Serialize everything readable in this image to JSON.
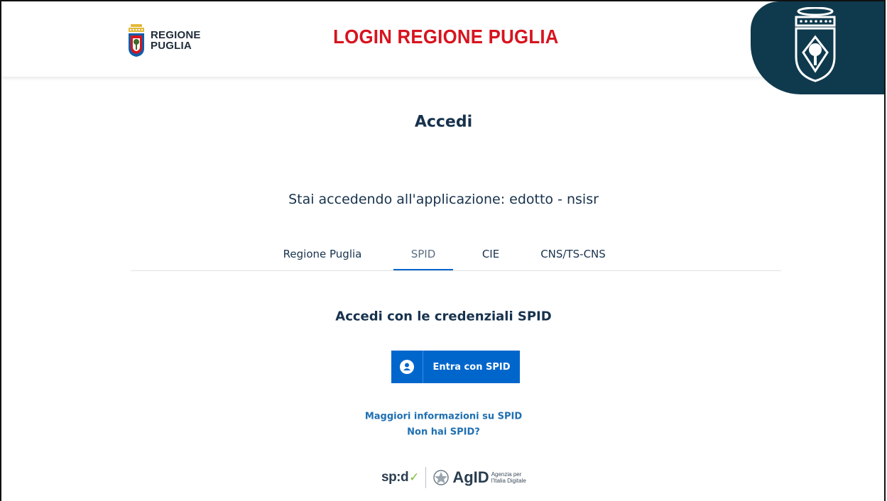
{
  "header": {
    "logo_line1": "REGIONE",
    "logo_line2": "PUGLIA",
    "title": "LOGIN REGIONE PUGLIA"
  },
  "main": {
    "page_title": "Accedi",
    "app_line": "Stai accedendo all'applicazione: edotto - nsisr",
    "tabs": [
      {
        "label": "Regione Puglia",
        "active": false
      },
      {
        "label": "SPID",
        "active": true
      },
      {
        "label": "CIE",
        "active": false
      },
      {
        "label": "CNS/TS-CNS",
        "active": false
      }
    ],
    "section_heading": "Accedi con le credenziali SPID",
    "spid_button_label": "Entra con SPID",
    "link_more_info": "Maggiori informazioni su SPID",
    "link_no_spid": "Non hai SPID?"
  },
  "footer": {
    "spid_logo": "sp:d",
    "agid_logo": "AgID",
    "agid_sub_line1": "Agenzia per",
    "agid_sub_line2": "l'Italia Digitale"
  },
  "colors": {
    "accent_red": "#d7141f",
    "primary_blue": "#0066cc",
    "navy_badge": "#0f3a4e",
    "text_dark": "#17324d",
    "link_blue": "#1f6fb2",
    "spid_green": "#7cbd3a"
  },
  "icons": {
    "logo": "regione-puglia-coat-of-arms-icon",
    "badge": "puglia-crest-icon",
    "spid_button": "user-icon",
    "agid": "italian-emblem-icon",
    "spid_check": "checkmark-icon"
  }
}
